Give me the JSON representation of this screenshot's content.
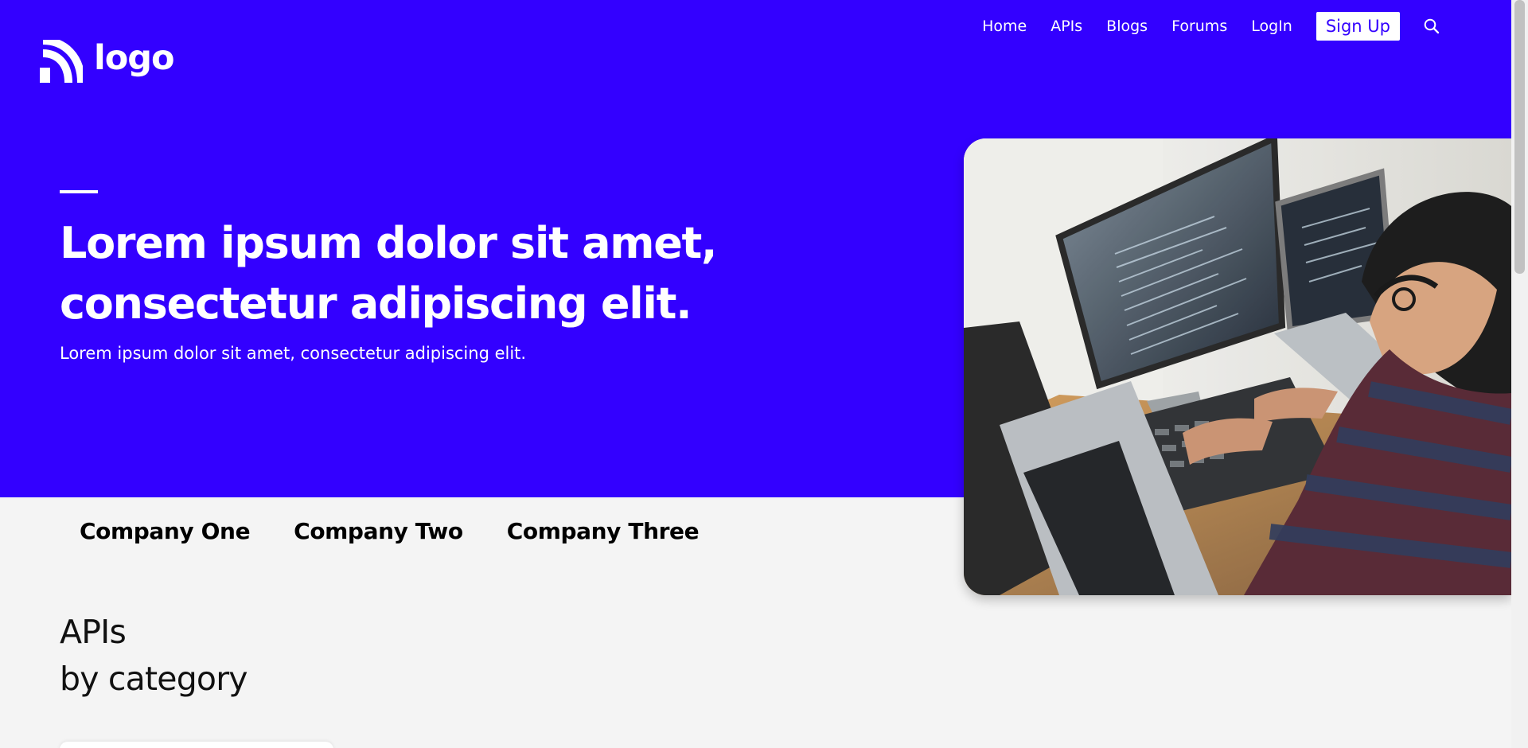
{
  "brand": {
    "logo_text": "logo",
    "primary_color": "#3300ff",
    "text_color": "#ffffff",
    "page_background": "#f4f4f4"
  },
  "nav": {
    "items": [
      "Home",
      "APIs",
      "Blogs",
      "Forums",
      "LogIn"
    ],
    "signup_label": "Sign Up",
    "search_icon": "search-icon"
  },
  "hero": {
    "title": "Lorem ipsum dolor sit amet, consectetur adipiscing elit.",
    "subtitle": "Lorem ipsum dolor sit amet, consectetur adipiscing elit.",
    "image": "developer-workspace"
  },
  "companies": [
    "Company One",
    "Company Two",
    "Company Three"
  ],
  "section": {
    "line1": "APIs",
    "line2": "by category"
  }
}
